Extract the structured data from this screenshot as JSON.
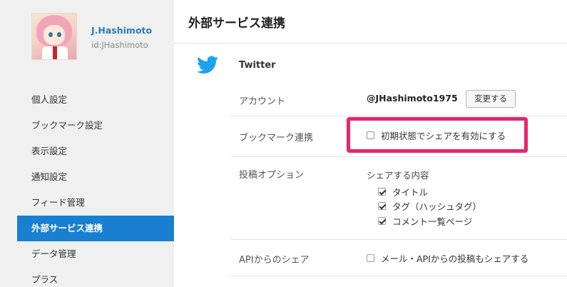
{
  "profile": {
    "display_name": "J.Hashimoto",
    "user_id": "id:JHashimoto"
  },
  "sidebar": {
    "items": [
      {
        "label": "個人設定",
        "active": false
      },
      {
        "label": "ブックマーク設定",
        "active": false
      },
      {
        "label": "表示設定",
        "active": false
      },
      {
        "label": "通知設定",
        "active": false
      },
      {
        "label": "フィード管理",
        "active": false
      },
      {
        "label": "外部サービス連携",
        "active": true
      },
      {
        "label": "データ管理",
        "active": false
      },
      {
        "label": "プラス",
        "active": false
      }
    ]
  },
  "main": {
    "title": "外部サービス連携",
    "service": {
      "name": "Twitter",
      "icon": "twitter-bird-icon",
      "brand_color": "#1da1f2"
    },
    "account": {
      "label": "アカウント",
      "value": "@JHashimoto1975",
      "change_button": "変更する"
    },
    "bookmark_link": {
      "label": "ブックマーク連携",
      "checkbox_label": "初期状態でシェアを有効にする",
      "checked": false
    },
    "post_options": {
      "label": "投稿オプション",
      "share_content_label": "シェアする内容",
      "options": [
        {
          "label": "タイトル",
          "checked": true
        },
        {
          "label": "タグ（ハッシュタグ）",
          "checked": true
        },
        {
          "label": "コメント一覧ページ",
          "checked": true
        }
      ]
    },
    "api_share": {
      "label": "APIからのシェア",
      "checkbox_label": "メール・APIからの投稿もシェアする",
      "checked": false
    }
  },
  "colors": {
    "active_nav": "#1a7fd0",
    "highlight": "#e8256f",
    "sidebar_bg": "#f0f0f0"
  }
}
